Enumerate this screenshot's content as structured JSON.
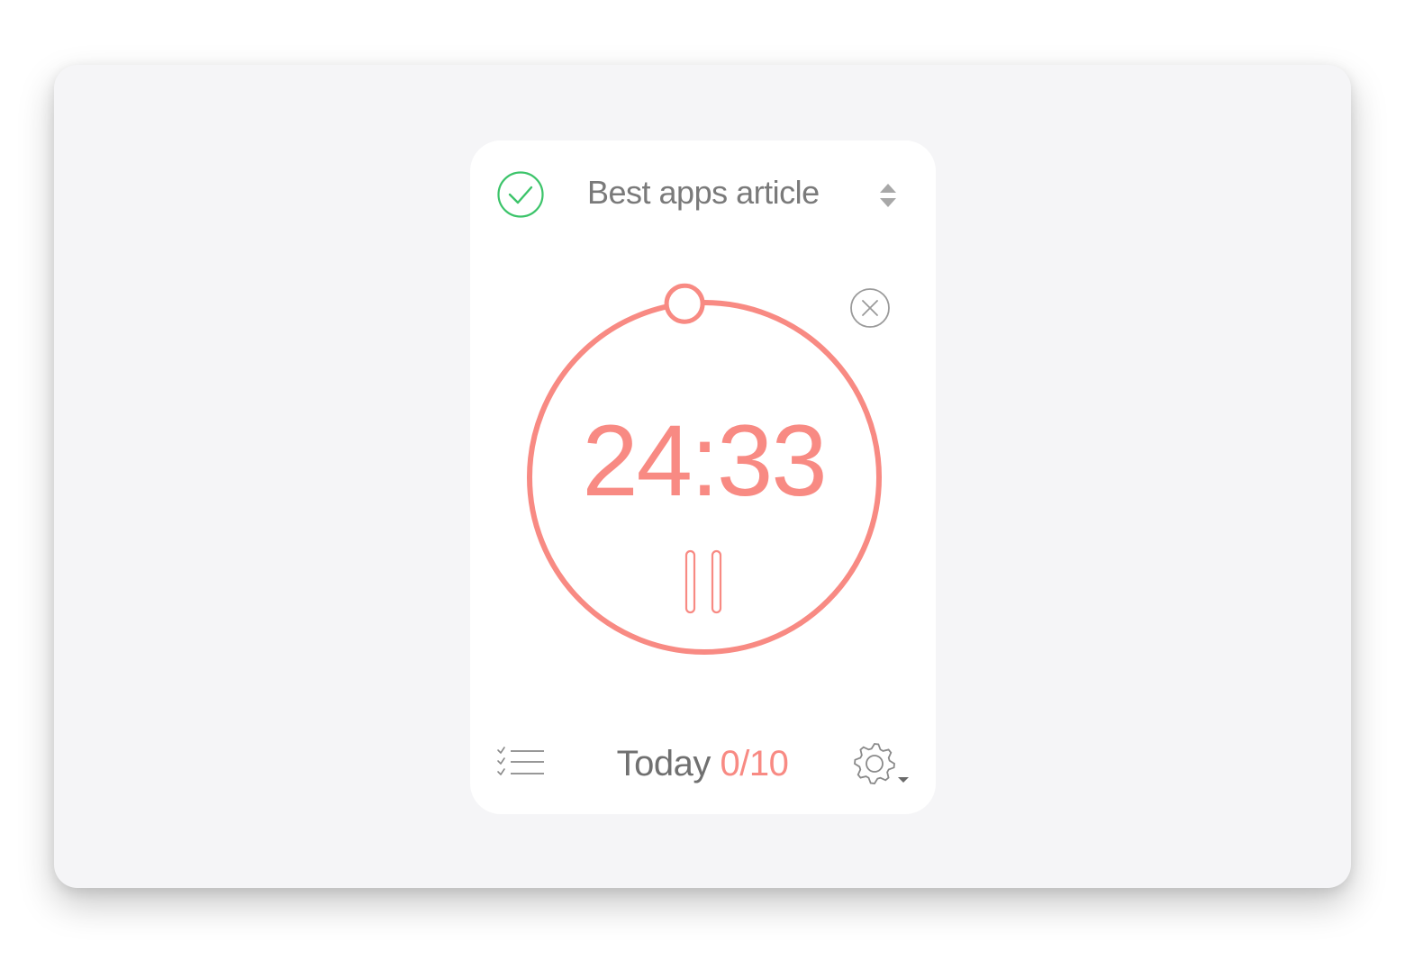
{
  "task": {
    "title": "Best apps article"
  },
  "timer": {
    "remaining": "24:33",
    "progress_fraction": 0.02
  },
  "footer": {
    "today_label": "Today",
    "today_count": "0/10"
  },
  "icons": {
    "complete": "check-circle-icon",
    "task_switch": "up-down-arrows-icon",
    "cancel": "close-circle-icon",
    "pause": "pause-icon",
    "task_list": "checklist-icon",
    "settings": "gear-icon"
  },
  "colors": {
    "accent": "#f88a83",
    "check": "#3cc46a",
    "muted": "#7a7a7a",
    "background": "#f5f5f7",
    "card": "#ffffff"
  }
}
